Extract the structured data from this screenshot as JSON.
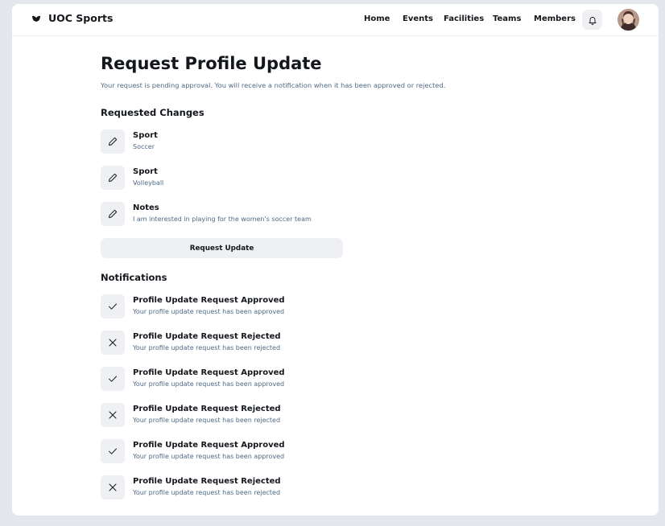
{
  "app": {
    "name": "UOC Sports"
  },
  "nav": {
    "items": [
      "Home",
      "Events",
      "Facilities",
      "Teams",
      "Members"
    ]
  },
  "page": {
    "title": "Request Profile Update",
    "subtitle": "Your request is pending approval. You will receive a notification when it has been approved or rejected."
  },
  "requested_changes": {
    "heading": "Requested Changes",
    "items": [
      {
        "label": "Sport",
        "value": "Soccer",
        "icon": "pencil-icon"
      },
      {
        "label": "Sport",
        "value": "Volleyball",
        "icon": "pencil-icon"
      },
      {
        "label": "Notes",
        "value": "I am interested in playing for the women's soccer team",
        "icon": "pencil-icon"
      }
    ]
  },
  "actions": {
    "request_update_label": "Request Update"
  },
  "notifications": {
    "heading": "Notifications",
    "items": [
      {
        "title": "Profile Update Request Approved",
        "message": "Your profile update request has been approved",
        "icon": "check-icon"
      },
      {
        "title": "Profile Update Request Rejected",
        "message": "Your profile update request has been rejected",
        "icon": "x-icon"
      },
      {
        "title": "Profile Update Request Approved",
        "message": "Your profile update request has been approved",
        "icon": "check-icon"
      },
      {
        "title": "Profile Update Request Rejected",
        "message": "Your profile update request has been rejected",
        "icon": "x-icon"
      },
      {
        "title": "Profile Update Request Approved",
        "message": "Your profile update request has been approved",
        "icon": "check-icon"
      },
      {
        "title": "Profile Update Request Rejected",
        "message": "Your profile update request has been rejected",
        "icon": "x-icon"
      }
    ]
  },
  "icons": {
    "brand": "logo-icon",
    "notifications": "bell-icon",
    "user": "avatar"
  },
  "colors": {
    "subtext": "#4f6a85",
    "surface": "#eef0f3",
    "background": "#e4e8ec"
  }
}
